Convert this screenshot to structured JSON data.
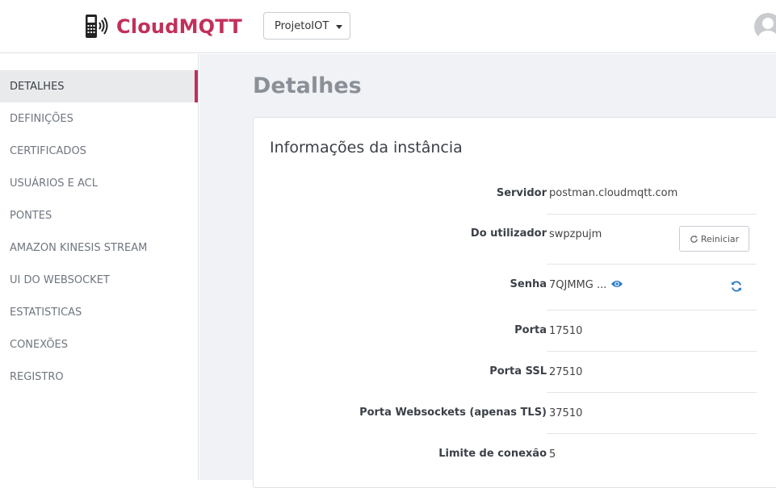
{
  "header": {
    "brand": "CloudMQTT",
    "instance": "ProjetoIOT"
  },
  "sidebar": {
    "items": [
      {
        "label": "DETALHES",
        "active": true
      },
      {
        "label": "DEFINIÇÕES"
      },
      {
        "label": "CERTIFICADOS"
      },
      {
        "label": "USUÁRIOS E ACL"
      },
      {
        "label": "PONTES"
      },
      {
        "label": "AMAZON KINESIS STREAM"
      },
      {
        "label": "UI DO WEBSOCKET"
      },
      {
        "label": "ESTATISTICAS"
      },
      {
        "label": "CONEXÕES"
      },
      {
        "label": "REGISTRO"
      }
    ]
  },
  "main": {
    "title": "Detalhes",
    "card_title": "Informações da instância",
    "rows": [
      {
        "label": "Servidor",
        "value": "postman.cloudmqtt.com"
      },
      {
        "label": "Do utilizador",
        "value": "swpzpujm"
      },
      {
        "label": "Senha",
        "value": "7QJMMG ..."
      },
      {
        "label": "Porta",
        "value": "17510"
      },
      {
        "label": "Porta SSL",
        "value": "27510"
      },
      {
        "label": "Porta Websockets (apenas TLS)",
        "value": "37510"
      },
      {
        "label": "Limite de conexão",
        "value": "5"
      }
    ],
    "restart_label": "Reiniciar"
  },
  "colors": {
    "brand": "#c2305a",
    "link_icon": "#2a7bc0"
  },
  "icons": [
    "phone-signal-logo-icon",
    "caret-down-icon",
    "avatar-user-icon",
    "refresh-icon",
    "eye-icon",
    "sync-icon"
  ]
}
